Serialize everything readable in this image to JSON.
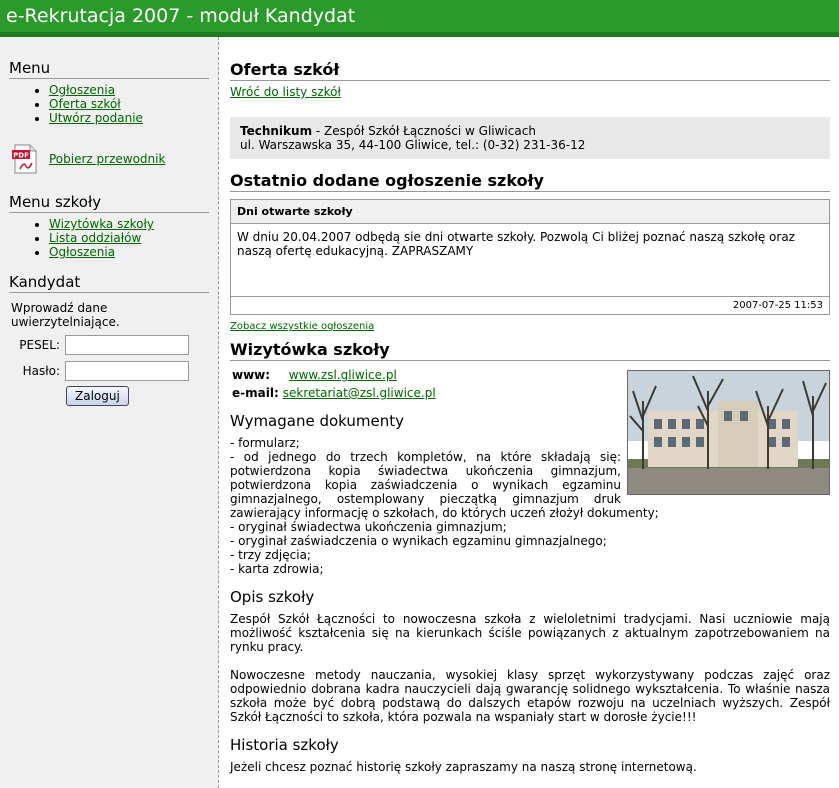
{
  "header": {
    "title": "e-Rekrutacja 2007 - moduł Kandydat"
  },
  "sidebar": {
    "menu_title": "Menu",
    "menu_items": [
      "Ogłoszenia",
      "Oferta szkół",
      "Utwórz podanie"
    ],
    "pdf_link": "Pobierz przewodnik",
    "school_menu_title": "Menu szkoły",
    "school_menu_items": [
      "Wizytówka szkoły",
      "Lista oddziałów",
      "Ogłoszenia"
    ],
    "candidate_title": "Kandydat",
    "login_text": "Wprowadź dane uwierzytelniające.",
    "pesel_label": "PESEL:",
    "password_label": "Hasło:",
    "login_button": "Zaloguj"
  },
  "main": {
    "offer_title": "Oferta szkół",
    "back_link": "Wróć do listy szkół",
    "school_type": "Technikum",
    "school_name": " - Zespół Szkół Łączności w Gliwicach",
    "school_address": "ul. Warszawska 35, 44-100 Gliwice, tel.: (0-32) 231-36-12",
    "latest_title": "Ostatnio dodane ogłoszenie szkoły",
    "announcement": {
      "title": "Dni otwarte szkoły",
      "body": "W dniu 20.04.2007 odbędą sie dni otwarte szkoły. Pozwolą Ci bliżej poznać naszą szkołę oraz naszą ofertę edukacyjną. ZAPRASZAMY",
      "date": "2007-07-25 11:53"
    },
    "all_announcements_link": "Zobacz wszystkie ogłoszenia",
    "card_title": "Wizytówka szkoły",
    "www_label": "www:",
    "www_value": "www.zsl.gliwice.pl",
    "email_label": "e-mail:",
    "email_value": "sekretariat@zsl.gliwice.pl",
    "docs_title": "Wymagane dokumenty",
    "docs_lines": [
      "- formularz;",
      "- od jednego do trzech kompletów, na które składają się: potwierdzona kopia świadectwa ukończenia gimnazjum, potwierdzona kopia zaświadczenia o wynikach egzaminu gimnazjalnego, ostemplowany pieczątką gimnazjum druk zawierający informację o szkołach, do których uczeń złożył dokumenty;",
      "- oryginał świadectwa ukończenia gimnazjum;",
      "- oryginał zaświadczenia o wynikach egzaminu gimnazjalnego;",
      "- trzy zdjęcia;",
      "- karta zdrowia;"
    ],
    "desc_title": "Opis szkoły",
    "desc_p1": "Zespół Szkół Łączności to nowoczesna szkoła z wieloletnimi tradycjami. Nasi uczniowie mają możliwość kształcenia się na kierunkach ściśle powiązanych z aktualnym zapotrzebowaniem na rynku pracy.",
    "desc_p2": "Nowoczesne metody nauczania, wysokiej klasy sprzęt wykorzystywany podczas zajęć oraz odpowiednio dobrana kadra nauczycieli dają gwarancję solidnego wykształcenia. To właśnie nasza szkoła może być dobrą podstawą do dalszych etapów rozwoju na uczelniach wyższych. Zespół Szkół Łączności to szkoła, która pozwala na wspaniały start w dorosłe życie!!!",
    "history_title": "Historia szkoły",
    "history_text": "Jeżeli chcesz poznać historię szkoły zapraszamy na naszą stronę internetową."
  }
}
